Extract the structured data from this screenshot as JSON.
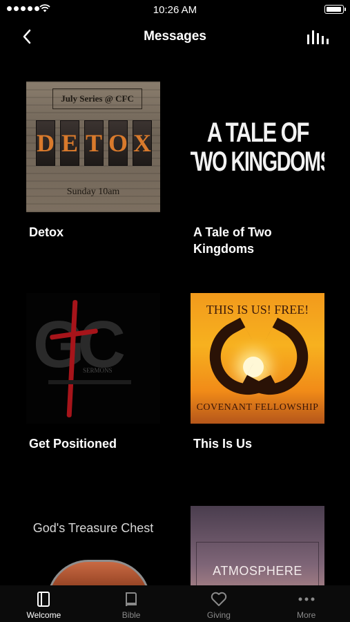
{
  "status_bar": {
    "time": "10:26 AM"
  },
  "nav": {
    "title": "Messages"
  },
  "series": [
    {
      "title": "Detox"
    },
    {
      "title": "A Tale of Two Kingdoms"
    },
    {
      "title": "Get Positioned"
    },
    {
      "title": "This Is Us"
    },
    {
      "title": ""
    },
    {
      "title": ""
    }
  ],
  "thumbnails": {
    "detox": {
      "banner": "July Series @ CFC",
      "letters": [
        "D",
        "E",
        "T",
        "O",
        "X"
      ],
      "sub": "Sunday 10am"
    },
    "tale": {
      "line1": "A TALE OF",
      "line2": "TWO KINGDOMS"
    },
    "get_positioned": {
      "sermons": "SERMONS"
    },
    "this_is_us": {
      "top": "THIS IS US! FREE!",
      "bottom": "COVENANT FELLOWSHIP"
    },
    "treasure": {
      "title": "God's Treasure Chest"
    },
    "atmosphere": {
      "title": "ATMOSPHERE"
    }
  },
  "tabs": [
    {
      "label": "Welcome",
      "icon": "book-open-icon",
      "active": true
    },
    {
      "label": "Bible",
      "icon": "bible-icon",
      "active": false
    },
    {
      "label": "Giving",
      "icon": "heart-icon",
      "active": false
    },
    {
      "label": "More",
      "icon": "more-dots-icon",
      "active": false
    }
  ],
  "colors": {
    "background": "#000000",
    "tab_active": "#ffffff",
    "tab_inactive": "#8a8a8a"
  }
}
